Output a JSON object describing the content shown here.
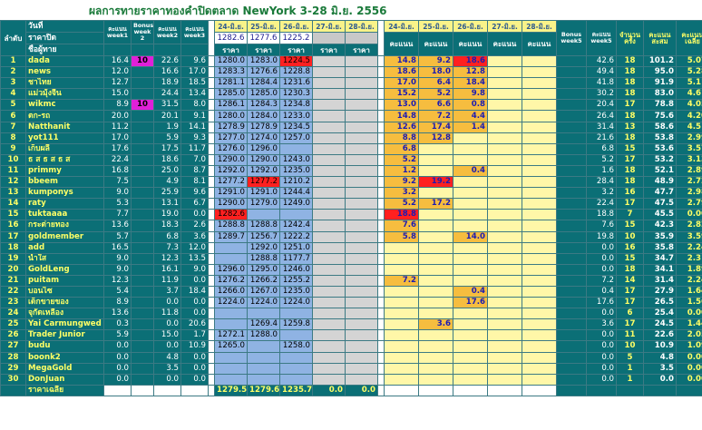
{
  "title": "ผลการทายราคาทองคำปิดตลาด NewYork 3-28 มิ.ย. 2556",
  "header": {
    "rank": "ลำดับ",
    "day": "วันที่",
    "close_price": "ราคาปิด",
    "player": "ชื่อผู้ทาย",
    "w1": "คะแนน week1",
    "bonus2": "Bonus week 2",
    "w2": "คะแนน week2",
    "w3": "คะแนน week3",
    "dates": [
      "24-มิ.ย.",
      "25-มิ.ย.",
      "26-มิ.ย.",
      "27-มิ.ย.",
      "28-มิ.ย."
    ],
    "close_values": [
      "1282.6",
      "1277.6",
      "1225.2",
      "",
      ""
    ],
    "price_label": "ราคา",
    "score_label": "คะแนน",
    "bonus5": "Bonus week5",
    "w5": "คะแนน week5",
    "count": "จำนวนครั้ง",
    "total": "คะแนนสะสม",
    "avg": "คะแนนเฉลี่ย"
  },
  "rows": [
    {
      "no": "1",
      "name": "dada",
      "w1": "16.4",
      "b2": "10",
      "w2": "22.6",
      "w3": "9.6",
      "p": [
        "1280.0",
        "1283.0",
        "1224.5",
        "",
        ""
      ],
      "s": [
        "14.8",
        "9.2",
        "18.6",
        "",
        ""
      ],
      "b5": "",
      "w5": "42.6",
      "cnt": "18",
      "tot": "101.2",
      "avg": "5.07"
    },
    {
      "no": "2",
      "name": "news",
      "w1": "12.0",
      "b2": "",
      "w2": "16.6",
      "w3": "17.0",
      "p": [
        "1283.3",
        "1276.6",
        "1228.8",
        "",
        ""
      ],
      "s": [
        "18.6",
        "18.0",
        "12.8",
        "",
        ""
      ],
      "b5": "",
      "w5": "49.4",
      "cnt": "18",
      "tot": "95.0",
      "avg": "5.28"
    },
    {
      "no": "3",
      "name": "ชาไทย",
      "w1": "12.7",
      "b2": "",
      "w2": "18.9",
      "w3": "18.5",
      "p": [
        "1281.1",
        "1284.4",
        "1231.6",
        "",
        ""
      ],
      "s": [
        "17.0",
        "6.4",
        "18.4",
        "",
        ""
      ],
      "b5": "",
      "w5": "41.8",
      "cnt": "18",
      "tot": "91.9",
      "avg": "5.11"
    },
    {
      "no": "4",
      "name": "แม่วมุ้งจื้น",
      "w1": "15.0",
      "b2": "",
      "w2": "24.4",
      "w3": "13.4",
      "p": [
        "1285.0",
        "1285.0",
        "1230.3",
        "",
        ""
      ],
      "s": [
        "15.2",
        "5.2",
        "9.8",
        "",
        ""
      ],
      "b5": "",
      "w5": "30.2",
      "cnt": "18",
      "tot": "83.0",
      "avg": "4.61"
    },
    {
      "no": "5",
      "name": "wikmc",
      "w1": "8.9",
      "b2": "10",
      "w2": "31.5",
      "w3": "8.0",
      "p": [
        "1286.1",
        "1284.3",
        "1234.8",
        "",
        ""
      ],
      "s": [
        "13.0",
        "6.6",
        "0.8",
        "",
        ""
      ],
      "b5": "",
      "w5": "20.4",
      "cnt": "17",
      "tot": "78.8",
      "avg": "4.05"
    },
    {
      "no": "6",
      "name": "ตก-รถ",
      "w1": "20.0",
      "b2": "",
      "w2": "20.1",
      "w3": "9.1",
      "p": [
        "1280.0",
        "1284.0",
        "1233.0",
        "",
        ""
      ],
      "s": [
        "14.8",
        "7.2",
        "4.4",
        "",
        ""
      ],
      "b5": "",
      "w5": "26.4",
      "cnt": "18",
      "tot": "75.6",
      "avg": "4.20"
    },
    {
      "no": "7",
      "name": "Natthanit",
      "w1": "11.2",
      "b2": "",
      "w2": "1.9",
      "w3": "14.1",
      "p": [
        "1278.9",
        "1278.9",
        "1234.5",
        "",
        ""
      ],
      "s": [
        "12.6",
        "17.4",
        "1.4",
        "",
        ""
      ],
      "b5": "",
      "w5": "31.4",
      "cnt": "13",
      "tot": "58.6",
      "avg": "4.51"
    },
    {
      "no": "8",
      "name": "yot111",
      "w1": "17.0",
      "b2": "",
      "w2": "5.9",
      "w3": "9.3",
      "p": [
        "1277.0",
        "1274.0",
        "1257.0",
        "",
        ""
      ],
      "s": [
        "8.8",
        "12.8",
        "",
        "",
        ""
      ],
      "b5": "",
      "w5": "21.6",
      "cnt": "18",
      "tot": "53.8",
      "avg": "2.99"
    },
    {
      "no": "9",
      "name": "เก็บผลี",
      "w1": "17.6",
      "b2": "",
      "w2": "17.5",
      "w3": "11.7",
      "p": [
        "1276.0",
        "1296.0",
        "",
        "",
        ""
      ],
      "s": [
        "6.8",
        "",
        "",
        "",
        ""
      ],
      "b5": "",
      "w5": "6.8",
      "cnt": "15",
      "tot": "53.6",
      "avg": "3.57"
    },
    {
      "no": "10",
      "name": "ธ ส ธ ส ธ ส",
      "w1": "22.4",
      "b2": "",
      "w2": "18.6",
      "w3": "7.0",
      "p": [
        "1290.0",
        "1290.0",
        "1243.0",
        "",
        ""
      ],
      "s": [
        "5.2",
        "",
        "",
        "",
        ""
      ],
      "b5": "",
      "w5": "5.2",
      "cnt": "17",
      "tot": "53.2",
      "avg": "3.13"
    },
    {
      "no": "11",
      "name": "primmy",
      "w1": "16.8",
      "b2": "",
      "w2": "25.0",
      "w3": "8.7",
      "p": [
        "1292.0",
        "1292.0",
        "1235.0",
        "",
        ""
      ],
      "s": [
        "1.2",
        "",
        "0.4",
        "",
        ""
      ],
      "b5": "",
      "w5": "1.6",
      "cnt": "18",
      "tot": "52.1",
      "avg": "2.89"
    },
    {
      "no": "12",
      "name": "bbeem",
      "w1": "7.5",
      "b2": "",
      "w2": "4.9",
      "w3": "8.1",
      "p": [
        "1277.2",
        "1277.2",
        "1210.2",
        "",
        ""
      ],
      "s": [
        "9.2",
        "19.2",
        "",
        "",
        ""
      ],
      "b5": "",
      "w5": "28.4",
      "cnt": "18",
      "tot": "48.9",
      "avg": "2.72"
    },
    {
      "no": "13",
      "name": "kumponys",
      "w1": "9.0",
      "b2": "",
      "w2": "25.9",
      "w3": "9.6",
      "p": [
        "1291.0",
        "1291.0",
        "1244.4",
        "",
        ""
      ],
      "s": [
        "3.2",
        "",
        "",
        "",
        ""
      ],
      "b5": "",
      "w5": "3.2",
      "cnt": "16",
      "tot": "47.7",
      "avg": "2.98"
    },
    {
      "no": "14",
      "name": "raty",
      "w1": "5.3",
      "b2": "",
      "w2": "13.1",
      "w3": "6.7",
      "p": [
        "1290.0",
        "1279.0",
        "1249.0",
        "",
        ""
      ],
      "s": [
        "5.2",
        "17.2",
        "",
        "",
        ""
      ],
      "b5": "",
      "w5": "22.4",
      "cnt": "17",
      "tot": "47.5",
      "avg": "2.79"
    },
    {
      "no": "15",
      "name": "tuktaaaa",
      "w1": "7.7",
      "b2": "",
      "w2": "19.0",
      "w3": "0.0",
      "p": [
        "1282.6",
        "",
        "",
        "",
        ""
      ],
      "s": [
        "18.8",
        "",
        "",
        "",
        ""
      ],
      "b5": "",
      "w5": "18.8",
      "cnt": "7",
      "tot": "45.5",
      "avg": "0.00"
    },
    {
      "no": "16",
      "name": "กระต่ายทอง",
      "w1": "13.6",
      "b2": "",
      "w2": "18.3",
      "w3": "2.6",
      "p": [
        "1288.8",
        "1288.8",
        "1242.4",
        "",
        ""
      ],
      "s": [
        "7.6",
        "",
        "",
        "",
        ""
      ],
      "b5": "",
      "w5": "7.6",
      "cnt": "15",
      "tot": "42.3",
      "avg": "2.82"
    },
    {
      "no": "17",
      "name": "goldmember",
      "w1": "5.7",
      "b2": "",
      "w2": "6.8",
      "w3": "3.6",
      "p": [
        "1289.7",
        "1256.7",
        "1222.2",
        "",
        ""
      ],
      "s": [
        "5.8",
        "",
        "14.0",
        "",
        ""
      ],
      "b5": "",
      "w5": "19.8",
      "cnt": "10",
      "tot": "35.9",
      "avg": "3.59"
    },
    {
      "no": "18",
      "name": "add",
      "w1": "16.5",
      "b2": "",
      "w2": "7.3",
      "w3": "12.0",
      "p": [
        "",
        "1292.0",
        "1251.0",
        "",
        ""
      ],
      "s": [
        "",
        "",
        "",
        "",
        ""
      ],
      "b5": "",
      "w5": "0.0",
      "cnt": "16",
      "tot": "35.8",
      "avg": "2.24"
    },
    {
      "no": "19",
      "name": "น้ำใส",
      "w1": "9.0",
      "b2": "",
      "w2": "12.3",
      "w3": "13.5",
      "p": [
        "",
        "1288.8",
        "1177.7",
        "",
        ""
      ],
      "s": [
        "",
        "",
        "",
        "",
        ""
      ],
      "b5": "",
      "w5": "0.0",
      "cnt": "15",
      "tot": "34.7",
      "avg": "2.31"
    },
    {
      "no": "20",
      "name": "GoldLeng",
      "w1": "9.0",
      "b2": "",
      "w2": "16.1",
      "w3": "9.0",
      "p": [
        "1296.0",
        "1295.0",
        "1246.0",
        "",
        ""
      ],
      "s": [
        "",
        "",
        "",
        "",
        ""
      ],
      "b5": "",
      "w5": "0.0",
      "cnt": "18",
      "tot": "34.1",
      "avg": "1.89"
    },
    {
      "no": "21",
      "name": "puitam",
      "w1": "12.3",
      "b2": "",
      "w2": "11.9",
      "w3": "0.0",
      "p": [
        "1276.2",
        "1266.2",
        "1255.2",
        "",
        ""
      ],
      "s": [
        "7.2",
        "",
        "",
        "",
        ""
      ],
      "b5": "",
      "w5": "7.2",
      "cnt": "14",
      "tot": "31.4",
      "avg": "2.24"
    },
    {
      "no": "22",
      "name": "บอนไซ",
      "w1": "5.4",
      "b2": "",
      "w2": "3.7",
      "w3": "18.4",
      "p": [
        "1266.0",
        "1267.0",
        "1235.0",
        "",
        ""
      ],
      "s": [
        "",
        "",
        "0.4",
        "",
        ""
      ],
      "b5": "",
      "w5": "0.4",
      "cnt": "17",
      "tot": "27.9",
      "avg": "1.64"
    },
    {
      "no": "23",
      "name": "เด็กขายของ",
      "w1": "8.9",
      "b2": "",
      "w2": "0.0",
      "w3": "0.0",
      "p": [
        "1224.0",
        "1224.0",
        "1224.0",
        "",
        ""
      ],
      "s": [
        "",
        "",
        "17.6",
        "",
        ""
      ],
      "b5": "",
      "w5": "17.6",
      "cnt": "17",
      "tot": "26.5",
      "avg": "1.56"
    },
    {
      "no": "24",
      "name": "จุกัดเหลือง",
      "w1": "13.6",
      "b2": "",
      "w2": "11.8",
      "w3": "0.0",
      "p": [
        "",
        "",
        "",
        "",
        ""
      ],
      "s": [
        "",
        "",
        "",
        "",
        ""
      ],
      "b5": "",
      "w5": "0.0",
      "cnt": "6",
      "tot": "25.4",
      "avg": "0.00"
    },
    {
      "no": "25",
      "name": "Yai Carmungwed",
      "w1": "0.3",
      "b2": "",
      "w2": "0.0",
      "w3": "20.6",
      "p": [
        "",
        "1269.4",
        "1259.8",
        "",
        ""
      ],
      "s": [
        "",
        "3.6",
        "",
        "",
        ""
      ],
      "b5": "",
      "w5": "3.6",
      "cnt": "17",
      "tot": "24.5",
      "avg": "1.44"
    },
    {
      "no": "26",
      "name": "Trader Junior",
      "w1": "5.9",
      "b2": "",
      "w2": "15.0",
      "w3": "1.7",
      "p": [
        "1272.1",
        "1288.0",
        "",
        "",
        ""
      ],
      "s": [
        "",
        "",
        "",
        "",
        ""
      ],
      "b5": "",
      "w5": "0.0",
      "cnt": "11",
      "tot": "22.6",
      "avg": "2.05"
    },
    {
      "no": "27",
      "name": "budu",
      "w1": "0.0",
      "b2": "",
      "w2": "0.0",
      "w3": "10.9",
      "p": [
        "1265.0",
        "",
        "1258.0",
        "",
        ""
      ],
      "s": [
        "",
        "",
        "",
        "",
        ""
      ],
      "b5": "",
      "w5": "0.0",
      "cnt": "10",
      "tot": "10.9",
      "avg": "1.09"
    },
    {
      "no": "28",
      "name": "boonk2",
      "w1": "0.0",
      "b2": "",
      "w2": "4.8",
      "w3": "0.0",
      "p": [
        "",
        "",
        "",
        "",
        ""
      ],
      "s": [
        "",
        "",
        "",
        "",
        ""
      ],
      "b5": "",
      "w5": "0.0",
      "cnt": "5",
      "tot": "4.8",
      "avg": "0.00"
    },
    {
      "no": "29",
      "name": "MegaGold",
      "w1": "0.0",
      "b2": "",
      "w2": "3.5",
      "w3": "0.0",
      "p": [
        "",
        "",
        "",
        "",
        ""
      ],
      "s": [
        "",
        "",
        "",
        "",
        ""
      ],
      "b5": "",
      "w5": "0.0",
      "cnt": "1",
      "tot": "3.5",
      "avg": "0.00"
    },
    {
      "no": "30",
      "name": "DonJuan",
      "w1": "0.0",
      "b2": "",
      "w2": "0.0",
      "w3": "0.0",
      "p": [
        "",
        "",
        "",
        "",
        ""
      ],
      "s": [
        "",
        "",
        "",
        "",
        ""
      ],
      "b5": "",
      "w5": "0.0",
      "cnt": "1",
      "tot": "0.0",
      "avg": "0.00"
    }
  ],
  "footer": {
    "label": "ราคาเฉลี่ย",
    "avg_prices": [
      "1279.5",
      "1279.6",
      "1235.7",
      "0.0",
      "0.0"
    ]
  },
  "colors": {
    "header_teal": "#0b6f76",
    "header_yellow_text": "#ffff66",
    "price_blue": "#8fb3e3",
    "score_yellow": "#fff7a8",
    "score_orange": "#f6bd3f",
    "exact_red": "#ff2020",
    "bonus_magenta": "#e020d8",
    "title_green": "#1a7a3a"
  },
  "highlights": {
    "red_score": [
      [
        1,
        2
      ],
      [
        12,
        1
      ],
      [
        15,
        0
      ]
    ],
    "orange_score": [
      [
        1,
        0
      ],
      [
        1,
        1
      ],
      [
        2,
        0
      ],
      [
        2,
        1
      ],
      [
        2,
        2
      ],
      [
        3,
        0
      ],
      [
        3,
        1
      ],
      [
        3,
        2
      ],
      [
        4,
        0
      ],
      [
        4,
        1
      ],
      [
        4,
        2
      ],
      [
        5,
        0
      ],
      [
        5,
        1
      ],
      [
        5,
        2
      ],
      [
        6,
        0
      ],
      [
        6,
        1
      ],
      [
        6,
        2
      ],
      [
        7,
        0
      ],
      [
        7,
        1
      ],
      [
        7,
        2
      ],
      [
        8,
        0
      ],
      [
        8,
        1
      ],
      [
        9,
        0
      ],
      [
        10,
        0
      ],
      [
        11,
        0
      ],
      [
        11,
        2
      ],
      [
        12,
        0
      ],
      [
        13,
        0
      ],
      [
        14,
        0
      ],
      [
        14,
        1
      ],
      [
        16,
        0
      ],
      [
        17,
        0
      ],
      [
        17,
        2
      ],
      [
        21,
        0
      ],
      [
        22,
        2
      ],
      [
        23,
        2
      ],
      [
        25,
        1
      ]
    ],
    "red_price": [
      [
        1,
        2
      ],
      [
        12,
        1
      ],
      [
        15,
        0
      ]
    ]
  }
}
